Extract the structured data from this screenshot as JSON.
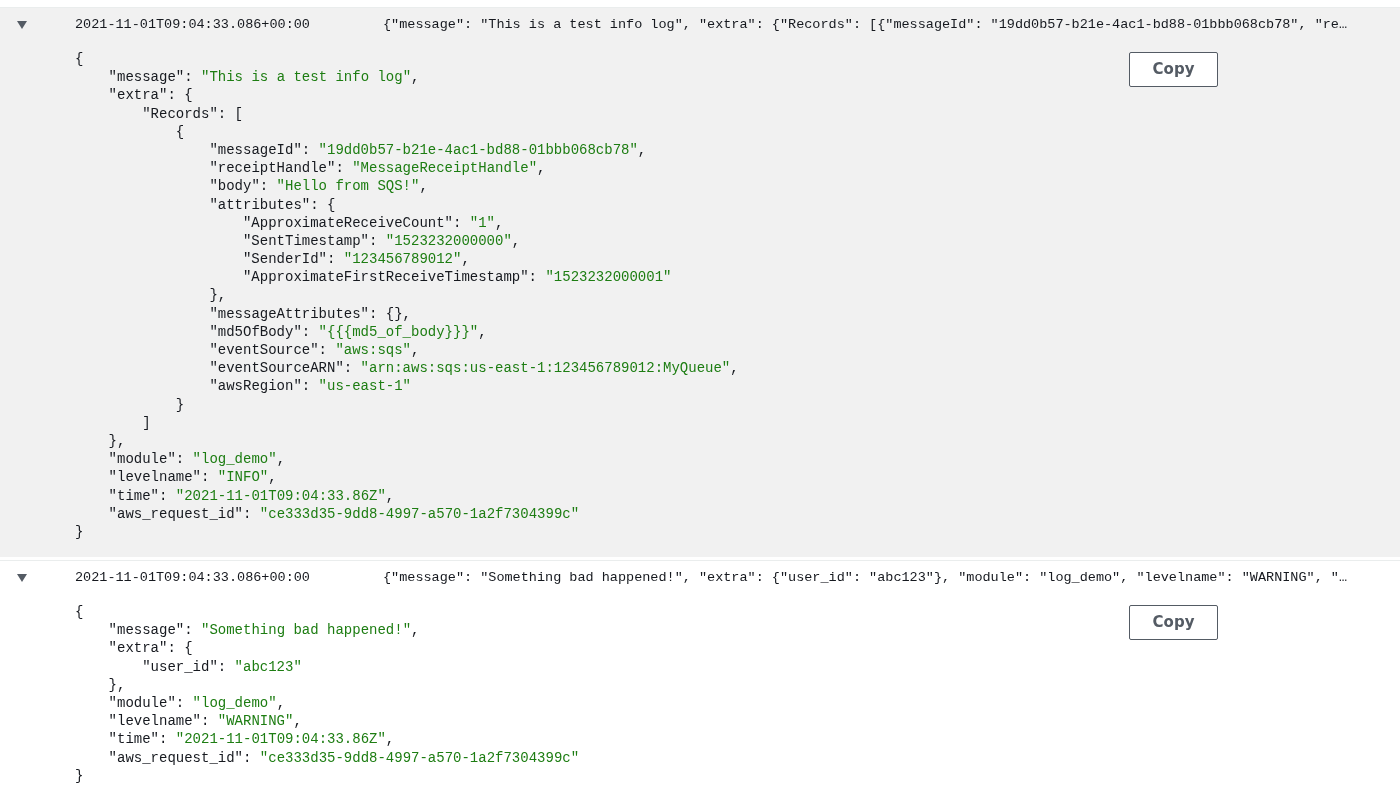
{
  "entries": [
    {
      "expanded": true,
      "highlighted": true,
      "timestamp": "2021-11-01T09:04:33.086+00:00",
      "summary": "{\"message\": \"This is a test info log\", \"extra\": {\"Records\": [{\"messageId\": \"19dd0b57-b21e-4ac1-bd88-01bbb068cb78\", \"re…",
      "copy_label": "Copy",
      "json": {
        "open": "{",
        "close": "}",
        "children": [
          {
            "key": "\"message\": ",
            "value": "\"This is a test info log\"",
            "end": ","
          },
          {
            "open": "\"extra\": {",
            "close": "},",
            "children": [
              {
                "open": "\"Records\": [",
                "close": "]",
                "children": [
                  {
                    "open": "{",
                    "close": "}",
                    "children": [
                      {
                        "key": "\"messageId\": ",
                        "value": "\"19dd0b57-b21e-4ac1-bd88-01bbb068cb78\"",
                        "end": ","
                      },
                      {
                        "key": "\"receiptHandle\": ",
                        "value": "\"MessageReceiptHandle\"",
                        "end": ","
                      },
                      {
                        "key": "\"body\": ",
                        "value": "\"Hello from SQS!\"",
                        "end": ","
                      },
                      {
                        "open": "\"attributes\": {",
                        "close": "},",
                        "children": [
                          {
                            "key": "\"ApproximateReceiveCount\": ",
                            "value": "\"1\"",
                            "end": ","
                          },
                          {
                            "key": "\"SentTimestamp\": ",
                            "value": "\"1523232000000\"",
                            "end": ","
                          },
                          {
                            "key": "\"SenderId\": ",
                            "value": "\"123456789012\"",
                            "end": ","
                          },
                          {
                            "key": "\"ApproximateFirstReceiveTimestamp\": ",
                            "value": "\"1523232000001\""
                          }
                        ]
                      },
                      {
                        "key": "\"messageAttributes\": {},"
                      },
                      {
                        "key": "\"md5OfBody\": ",
                        "value": "\"{{{md5_of_body}}}\"",
                        "end": ","
                      },
                      {
                        "key": "\"eventSource\": ",
                        "value": "\"aws:sqs\"",
                        "end": ","
                      },
                      {
                        "key": "\"eventSourceARN\": ",
                        "value": "\"arn:aws:sqs:us-east-1:123456789012:MyQueue\"",
                        "end": ","
                      },
                      {
                        "key": "\"awsRegion\": ",
                        "value": "\"us-east-1\""
                      }
                    ]
                  }
                ]
              }
            ]
          },
          {
            "key": "\"module\": ",
            "value": "\"log_demo\"",
            "end": ","
          },
          {
            "key": "\"levelname\": ",
            "value": "\"INFO\"",
            "end": ","
          },
          {
            "key": "\"time\": ",
            "value": "\"2021-11-01T09:04:33.86Z\"",
            "end": ","
          },
          {
            "key": "\"aws_request_id\": ",
            "value": "\"ce333d35-9dd8-4997-a570-1a2f7304399c\""
          }
        ]
      }
    },
    {
      "expanded": true,
      "highlighted": false,
      "timestamp": "2021-11-01T09:04:33.086+00:00",
      "summary": "{\"message\": \"Something bad happened!\", \"extra\": {\"user_id\": \"abc123\"}, \"module\": \"log_demo\", \"levelname\": \"WARNING\", \"…",
      "copy_label": "Copy",
      "json": {
        "open": "{",
        "close": "}",
        "children": [
          {
            "key": "\"message\": ",
            "value": "\"Something bad happened!\"",
            "end": ","
          },
          {
            "open": "\"extra\": {",
            "close": "},",
            "children": [
              {
                "key": "\"user_id\": ",
                "value": "\"abc123\""
              }
            ]
          },
          {
            "key": "\"module\": ",
            "value": "\"log_demo\"",
            "end": ","
          },
          {
            "key": "\"levelname\": ",
            "value": "\"WARNING\"",
            "end": ","
          },
          {
            "key": "\"time\": ",
            "value": "\"2021-11-01T09:04:33.86Z\"",
            "end": ","
          },
          {
            "key": "\"aws_request_id\": ",
            "value": "\"ce333d35-9dd8-4997-a570-1a2f7304399c\""
          }
        ]
      }
    }
  ]
}
